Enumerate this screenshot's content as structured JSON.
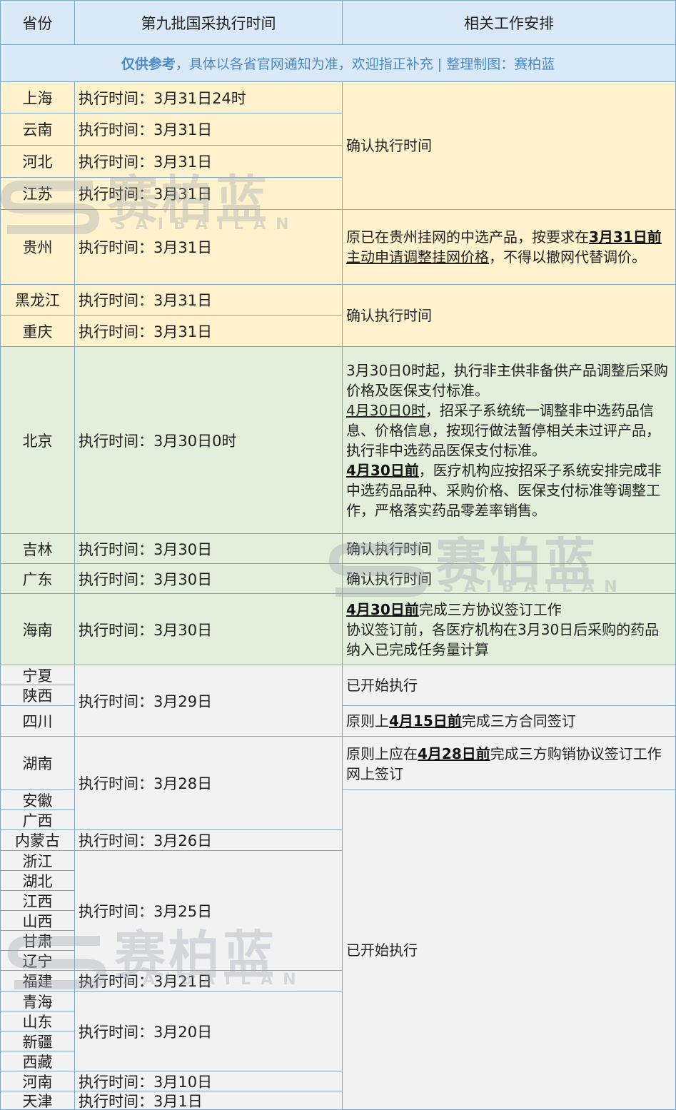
{
  "header": {
    "province": "省份",
    "time": "第九批国采执行时间",
    "work": "相关工作安排"
  },
  "note": {
    "bold": "仅供参考",
    "rest": "，具体以各省官网通知为准，欢迎指正补充 | 整理制图：赛柏蓝"
  },
  "watermark": {
    "cn": "赛柏蓝",
    "en": "SAIBAILAN"
  },
  "colors": {
    "yellow": "#fff2cc",
    "green": "#e2efda",
    "grey": "#f2f2f2",
    "header": "#dae9f7",
    "border": "#7fa7c9",
    "note_text": "#4a89c6"
  },
  "provinces": [
    "上海",
    "云南",
    "河北",
    "江苏",
    "贵州",
    "黑龙江",
    "重庆",
    "北京",
    "吉林",
    "广东",
    "海南",
    "宁夏",
    "陕西",
    "四川",
    "湖南",
    "安徽",
    "广西",
    "内蒙古",
    "浙江",
    "湖北",
    "江西",
    "山西",
    "甘肃",
    "辽宁",
    "福建",
    "青海",
    "山东",
    "新疆",
    "西藏",
    "河南",
    "天津"
  ],
  "times": [
    "执行时间：3月31日24时",
    "执行时间：3月31日",
    "执行时间：3月31日",
    "执行时间：3月31日",
    "执行时间：3月31日",
    "执行时间：3月31日",
    "执行时间：3月31日",
    "执行时间：3月30日0时",
    "执行时间：3月30日",
    "执行时间：3月30日",
    "执行时间：3月30日",
    "执行时间：3月29日",
    "执行时间：3月28日",
    "执行时间：3月26日",
    "执行时间：3月25日",
    "执行时间：3月21日",
    "执行时间：3月20日",
    "执行时间：3月10日",
    "执行时间：3月1日"
  ],
  "works": [
    {
      "segments": [
        {
          "t": "确认执行时间"
        }
      ]
    },
    {
      "segments": [
        {
          "t": "原已在贵州挂网的中选产品，按要求在"
        },
        {
          "t": "3月31日前",
          "s": "hl"
        },
        {
          "t": "主动申请调整挂网价格",
          "s": "ul"
        },
        {
          "t": "，不得以撤网代替调价。"
        }
      ]
    },
    {
      "segments": [
        {
          "t": "确认执行时间"
        }
      ]
    },
    {
      "segments": [
        {
          "t": "3月30日0时起，执行非主供非备供产品调整后采购价格及医保支付标准。"
        },
        {
          "t": "\n"
        },
        {
          "t": "4月30日0时",
          "s": "ul"
        },
        {
          "t": "，招采子系统统一调整非中选药品信息、价格信息，按现行做法暂停相关未过评产品，执行非中选药品医保支付标准。"
        },
        {
          "t": "\n"
        },
        {
          "t": "4月30日前",
          "s": "hl"
        },
        {
          "t": "，医疗机构应按招采子系统安排完成非中选药品品种、采购价格、医保支付标准等调整工作，严格落实药品零差率销售。"
        }
      ]
    },
    {
      "segments": [
        {
          "t": "确认执行时间"
        }
      ]
    },
    {
      "segments": [
        {
          "t": "确认执行时间"
        }
      ]
    },
    {
      "segments": [
        {
          "t": "4月30日前",
          "s": "hl"
        },
        {
          "t": "完成三方协议签订工作"
        },
        {
          "t": "\n"
        },
        {
          "t": "协议签订前，各医疗机构在3月30日后采购的药品纳入已完成任务量计算"
        }
      ]
    },
    {
      "segments": [
        {
          "t": "已开始执行"
        }
      ]
    },
    {
      "segments": [
        {
          "t": "原则上"
        },
        {
          "t": "4月15日前",
          "s": "hl"
        },
        {
          "t": "完成三方合同签订"
        }
      ]
    },
    {
      "segments": [
        {
          "t": "原则上应在"
        },
        {
          "t": "4月28日前",
          "s": "hl"
        },
        {
          "t": "完成三方购销协议签订工作网上签订"
        }
      ]
    },
    {
      "segments": [
        {
          "t": "已开始执行"
        }
      ]
    }
  ]
}
